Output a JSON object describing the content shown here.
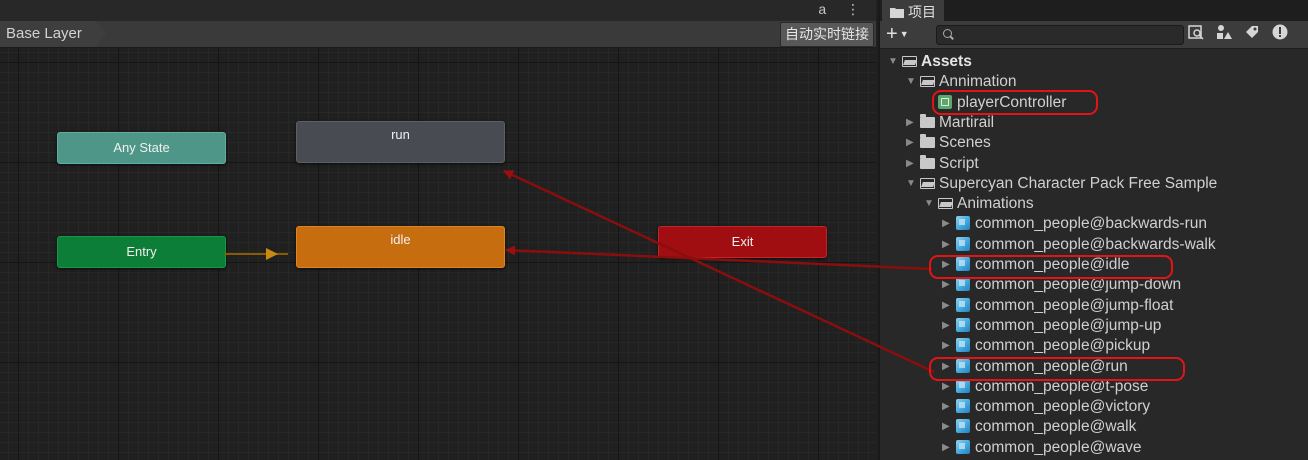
{
  "animator": {
    "breadcrumb": "Base Layer",
    "autolink_label": "自动实时链接",
    "topbar_icons": "a ⋮",
    "nodes": {
      "any_state": "Any State",
      "run": "run",
      "entry": "Entry",
      "idle": "idle",
      "exit": "Exit"
    }
  },
  "project": {
    "tab_label": "项目",
    "search": {
      "value": "",
      "placeholder": ""
    },
    "tree": [
      {
        "label": "Assets",
        "expanded": true,
        "icon": "folder-open-icon",
        "bold": true
      },
      {
        "label": "Annimation",
        "expanded": true,
        "icon": "folder-open-icon"
      },
      {
        "label": "playerController",
        "icon": "animator-controller-icon",
        "highlighted": true
      },
      {
        "label": "Martirail",
        "expanded": false,
        "icon": "folder-icon"
      },
      {
        "label": "Scenes",
        "expanded": false,
        "icon": "folder-icon"
      },
      {
        "label": "Script",
        "expanded": false,
        "icon": "folder-icon"
      },
      {
        "label": "Supercyan Character Pack Free Sample",
        "expanded": true,
        "icon": "folder-open-icon"
      },
      {
        "label": "Animations",
        "expanded": true,
        "icon": "folder-open-icon"
      },
      {
        "label": "common_people@backwards-run",
        "icon": "model-icon"
      },
      {
        "label": "common_people@backwards-walk",
        "icon": "model-icon"
      },
      {
        "label": "common_people@idle",
        "icon": "model-icon",
        "highlighted": true
      },
      {
        "label": "common_people@jump-down",
        "icon": "model-icon"
      },
      {
        "label": "common_people@jump-float",
        "icon": "model-icon"
      },
      {
        "label": "common_people@jump-up",
        "icon": "model-icon"
      },
      {
        "label": "common_people@pickup",
        "icon": "model-icon"
      },
      {
        "label": "common_people@run",
        "icon": "model-icon",
        "highlighted": true
      },
      {
        "label": "common_people@t-pose",
        "icon": "model-icon"
      },
      {
        "label": "common_people@victory",
        "icon": "model-icon"
      },
      {
        "label": "common_people@walk",
        "icon": "model-icon"
      },
      {
        "label": "common_people@wave",
        "icon": "model-icon"
      }
    ]
  },
  "colors": {
    "any_state": "#4d9688",
    "entry": "#0c7e37",
    "run": "#484c52",
    "idle_default": "#c66e0f",
    "exit": "#a10e12",
    "annotation_red": "#e11515",
    "drag_arrow": "#8b0d0d"
  }
}
